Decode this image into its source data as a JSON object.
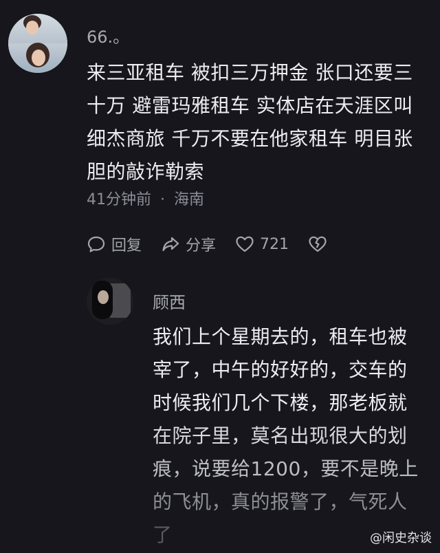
{
  "comment": {
    "username": "66.。",
    "text_lines": [
      "来三亚租车 被扣三万押金 张口还要三",
      "十万 避雷玛雅租车 实体店在天涯区叫",
      "细杰商旅 千万不要在他家租车 明目张",
      "胆的敲诈勒索"
    ],
    "time": "41分钟前",
    "separator": "·",
    "location": "海南",
    "actions": {
      "reply_label": "回复",
      "share_label": "分享",
      "like_count": "721",
      "reply_icon": "speech-bubble-icon",
      "share_icon": "share-arrow-icon",
      "like_icon": "heart-icon",
      "dislike_icon": "broken-heart-icon"
    }
  },
  "reply": {
    "username": "顾西",
    "text_lines": [
      "我们上个星期去的，租车也被",
      "宰了，中午的好好的，交车的",
      "时候我们几个下楼，那老板就",
      "在院子里，莫名出现很大的划",
      "痕，说要给1200，要不是晚上",
      "的飞机，真的报警了，气死人",
      "了"
    ]
  },
  "watermark": "@闲史杂谈",
  "colors": {
    "background": "#16161c",
    "primary_text": "#ececf1",
    "secondary_text": "#a9a9b3"
  }
}
